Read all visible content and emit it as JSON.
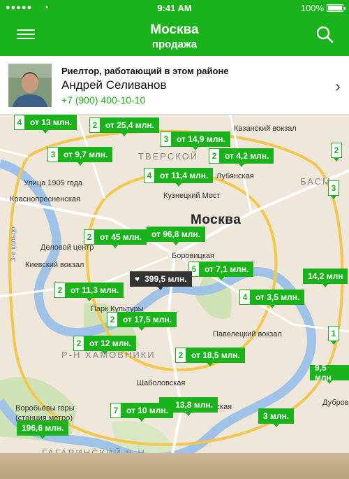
{
  "status": {
    "time": "9:41 AM",
    "battery": "100%"
  },
  "header": {
    "title": "Москва",
    "subtitle": "продажа"
  },
  "realtor": {
    "caption": "Риелтор, работающий в этом районе",
    "name": "Андрей Селиванов",
    "phone": "+7 (900) 400-10-10"
  },
  "map": {
    "city_label": "Москва",
    "labels": [
      {
        "text": "Казанский вокзал",
        "kind": "poi"
      },
      {
        "text": "ТВЕРСКОЙ",
        "kind": "dist"
      },
      {
        "text": "БАСМ",
        "kind": "dist"
      },
      {
        "text": "Улица 1905 года",
        "kind": "poi"
      },
      {
        "text": "Краснопресненская",
        "kind": "poi"
      },
      {
        "text": "Кузнецкий Мост",
        "kind": "poi"
      },
      {
        "text": "Лубянская",
        "kind": "poi"
      },
      {
        "text": "Деловой центр",
        "kind": "poi"
      },
      {
        "text": "Боровицкая",
        "kind": "poi"
      },
      {
        "text": "Киевский вокзал",
        "kind": "poi"
      },
      {
        "text": "Парк Культуры",
        "kind": "poi"
      },
      {
        "text": "Павелецкий вокзал",
        "kind": "poi"
      },
      {
        "text": "Р-Н ХАМОВНИКИ",
        "kind": "dist"
      },
      {
        "text": "Шаболовская",
        "kind": "poi"
      },
      {
        "text": "Воробьёвы горы",
        "kind": "poi"
      },
      {
        "text": "(станция метро)",
        "kind": "poi"
      },
      {
        "text": "Тульская",
        "kind": "poi"
      },
      {
        "text": "Дубров",
        "kind": "poi"
      },
      {
        "text": "ГАГАРИНСКИЙ Р-Н",
        "kind": "dist"
      },
      {
        "text": "3-е кольцо",
        "kind": "road"
      }
    ],
    "pins": [
      {
        "count": "4",
        "price": "от 13 млн."
      },
      {
        "count": "2",
        "price": "от 25,4 млн."
      },
      {
        "count": "3",
        "price": "от 14,9 млн."
      },
      {
        "count": "3",
        "price": "от 9,7 млн."
      },
      {
        "count": "2",
        "price": "от 4,2 млн."
      },
      {
        "count": "4",
        "price": "от 11,4 млн."
      },
      {
        "count": "2",
        "price": "от 45 млн."
      },
      {
        "count": "",
        "price": "от 96,8 млн."
      },
      {
        "count": "5",
        "price": "от 7,1 млн."
      },
      {
        "count": "",
        "price": "399,5 млн.",
        "favorite": true
      },
      {
        "count": "2",
        "price": "от 11,3 млн."
      },
      {
        "count": "4",
        "price": "от 3,5 млн."
      },
      {
        "count": "2",
        "price": "от 17,5 млн."
      },
      {
        "count": "2",
        "price": "от 12 млн."
      },
      {
        "count": "2",
        "price": "от 18,5 млн."
      },
      {
        "count": "",
        "price": "от 13,8 млн."
      },
      {
        "count": "7",
        "price": "от 10 млн."
      },
      {
        "count": "",
        "price": "3 млн."
      },
      {
        "count": "",
        "price": "196,6 млн."
      },
      {
        "count": "",
        "price": "14,2 млн"
      },
      {
        "count": "",
        "price": "9,5 млн"
      },
      {
        "count": "2",
        "price": ""
      },
      {
        "count": "3",
        "price": ""
      },
      {
        "count": "1",
        "price": ""
      }
    ]
  },
  "colors": {
    "brand": "#1bb31b",
    "map_bg": "#efe7d9"
  }
}
